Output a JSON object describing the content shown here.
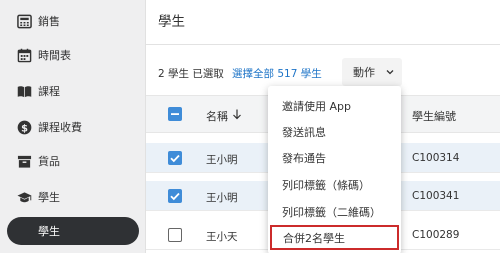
{
  "sidebar": {
    "items": [
      {
        "label": "銷售",
        "icon": "register-icon"
      },
      {
        "label": "時間表",
        "icon": "calendar-icon"
      },
      {
        "label": "課程",
        "icon": "book-icon"
      },
      {
        "label": "課程收費",
        "icon": "dollar-icon"
      },
      {
        "label": "貨品",
        "icon": "archive-box-icon"
      },
      {
        "label": "學生",
        "icon": "graduation-cap-icon"
      },
      {
        "label": "學生",
        "icon": "",
        "active": true
      }
    ]
  },
  "main": {
    "title": "學生",
    "selection_info": "2 學生 已選取",
    "select_all": "選擇全部 517 學生",
    "action_button": "動作"
  },
  "table": {
    "headers": {
      "name": "名稱",
      "id": "學生編號"
    },
    "rows": [
      {
        "name": "王小明",
        "id": "C100314",
        "checked": true
      },
      {
        "name": "王小明",
        "id": "C100341",
        "checked": true
      },
      {
        "name": "王小天",
        "id": "C100289",
        "checked": false
      }
    ]
  },
  "dropdown": {
    "items": [
      {
        "label": "邀請使用 App"
      },
      {
        "label": "發送訊息"
      },
      {
        "label": "發布通告"
      },
      {
        "label": "列印標籤（條碼）"
      },
      {
        "label": "列印標籤（二維碼）"
      },
      {
        "label": "合併2名學生",
        "highlighted": true
      }
    ]
  },
  "colors": {
    "accent_blue": "#3f8cd8",
    "link_blue": "#1e74c7",
    "highlight_red": "#cc2b2b",
    "active_nav": "#2f3134"
  }
}
